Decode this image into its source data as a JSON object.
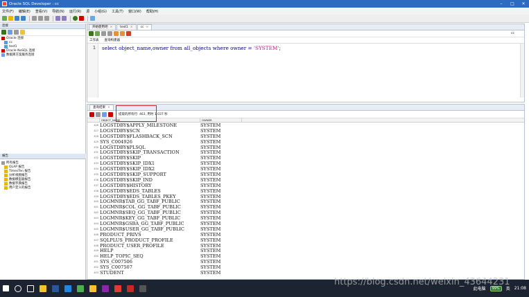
{
  "window": {
    "title": "Oracle SQL Developer : cc"
  },
  "menu": [
    "文件(F)",
    "编辑(E)",
    "查看(V)",
    "导航(N)",
    "运行(R)",
    "源",
    "小组(G)",
    "工具(T)",
    "窗口(W)",
    "帮助(H)"
  ],
  "connections_panel": {
    "title": "连接",
    "items": [
      {
        "label": "Oracle 连接",
        "indent": 0
      },
      {
        "label": "cc",
        "indent": 1
      },
      {
        "label": "test1",
        "indent": 1
      },
      {
        "label": "Oracle NoSQL 连接",
        "indent": 0
      },
      {
        "label": "数据库方案服务连接",
        "indent": 0
      }
    ]
  },
  "reports_panel": {
    "title": "报告",
    "items": [
      {
        "label": "所有报告",
        "indent": 0
      },
      {
        "label": "OLAP 报告",
        "indent": 1
      },
      {
        "label": "TimesTen 报告",
        "indent": 1
      },
      {
        "label": "分析视图报告",
        "indent": 1
      },
      {
        "label": "数据模型器报告",
        "indent": 1
      },
      {
        "label": "数据字典报告",
        "indent": 1
      },
      {
        "label": "用户定义的报告",
        "indent": 1
      }
    ]
  },
  "editor": {
    "tabs": [
      {
        "label": "开始使用吧",
        "close": "×"
      },
      {
        "label": "test1",
        "close": "×"
      },
      {
        "label": "cc",
        "close": "×"
      }
    ],
    "active_tab": 2,
    "connection": "cc",
    "subtabs": [
      "工作表",
      "查询构建器"
    ],
    "line_number": "1",
    "sql": {
      "kw1": "select ",
      "cols": "object_name,owner ",
      "kw2": "from ",
      "tbl": "all_objects ",
      "kw3": "where ",
      "col": "owner ",
      "op": "= ",
      "str": "'SYSTEM'",
      "end": ";"
    }
  },
  "results": {
    "tab_label": "查询结果",
    "tab_close": "×",
    "status_text": "提取的所有行: 463, 用时 1.037 秒",
    "columns": [
      "OBJECT_NAME",
      "OWNER"
    ],
    "rows": [
      {
        "n": "426",
        "name": "LOGSTDBY$APPLY_MILESTONE",
        "owner": "SYSTEM"
      },
      {
        "n": "427",
        "name": "LOGSTDBY$SCN",
        "owner": "SYSTEM"
      },
      {
        "n": "428",
        "name": "LOGSTDBY$FLASHBACK_SCN",
        "owner": "SYSTEM"
      },
      {
        "n": "429",
        "name": "SYS_C004926",
        "owner": "SYSTEM"
      },
      {
        "n": "430",
        "name": "LOGSTDBY$PLSQL",
        "owner": "SYSTEM"
      },
      {
        "n": "431",
        "name": "LOGSTDBY$SKIP_TRANSACTION",
        "owner": "SYSTEM"
      },
      {
        "n": "432",
        "name": "LOGSTDBY$SKIP",
        "owner": "SYSTEM"
      },
      {
        "n": "433",
        "name": "LOGSTDBY$SKIP_IDX1",
        "owner": "SYSTEM"
      },
      {
        "n": "434",
        "name": "LOGSTDBY$SKIP_IDX2",
        "owner": "SYSTEM"
      },
      {
        "n": "435",
        "name": "LOGSTDBY$SKIP_SUPPORT",
        "owner": "SYSTEM"
      },
      {
        "n": "436",
        "name": "LOGSTDBY$SKIP_IND",
        "owner": "SYSTEM"
      },
      {
        "n": "437",
        "name": "LOGSTDBY$HISTORY",
        "owner": "SYSTEM"
      },
      {
        "n": "438",
        "name": "LOGSTDBY$EDS_TABLES",
        "owner": "SYSTEM"
      },
      {
        "n": "439",
        "name": "LOGSTDBY$EDS_TABLES_PKEY",
        "owner": "SYSTEM"
      },
      {
        "n": "440",
        "name": "LOGMNR$TAB_GG_TABF_PUBLIC",
        "owner": "SYSTEM"
      },
      {
        "n": "441",
        "name": "LOGMNR$COL_GG_TABF_PUBLIC",
        "owner": "SYSTEM"
      },
      {
        "n": "442",
        "name": "LOGMNR$SEQ_GG_TABF_PUBLIC",
        "owner": "SYSTEM"
      },
      {
        "n": "443",
        "name": "LOGMNR$KEY_GG_TABF_PUBLIC",
        "owner": "SYSTEM"
      },
      {
        "n": "444",
        "name": "LOGMNR$GSBA_GG_TABF_PUBLIC",
        "owner": "SYSTEM"
      },
      {
        "n": "445",
        "name": "LOGMNR$USER_GG_TABF_PUBLIC",
        "owner": "SYSTEM"
      },
      {
        "n": "446",
        "name": "PRODUCT_PRIVS",
        "owner": "SYSTEM"
      },
      {
        "n": "447",
        "name": "SQLPLUS_PRODUCT_PROFILE",
        "owner": "SYSTEM"
      },
      {
        "n": "448",
        "name": "PRODUCT_USER_PROFILE",
        "owner": "SYSTEM"
      },
      {
        "n": "449",
        "name": "HELP",
        "owner": "SYSTEM"
      },
      {
        "n": "450",
        "name": "HELP_TOPIC_SEQ",
        "owner": "SYSTEM"
      },
      {
        "n": "451",
        "name": "SYS_C007506",
        "owner": "SYSTEM"
      },
      {
        "n": "452",
        "name": "SYS_C007507",
        "owner": "SYSTEM"
      },
      {
        "n": "453",
        "name": "STUDENT",
        "owner": "SYSTEM"
      }
    ]
  },
  "taskbar": {
    "tray_text": "此电脑",
    "battery": "99%",
    "ime": "英",
    "time": "21:08"
  },
  "watermark": "https://blog.csdn.net/weixin_43644231",
  "colors": {
    "titlebar": "#2c6bc0",
    "accent_red": "#d62020",
    "sql_keyword": "#000080",
    "sql_string": "#c71585",
    "taskbar": "#1c2431"
  }
}
